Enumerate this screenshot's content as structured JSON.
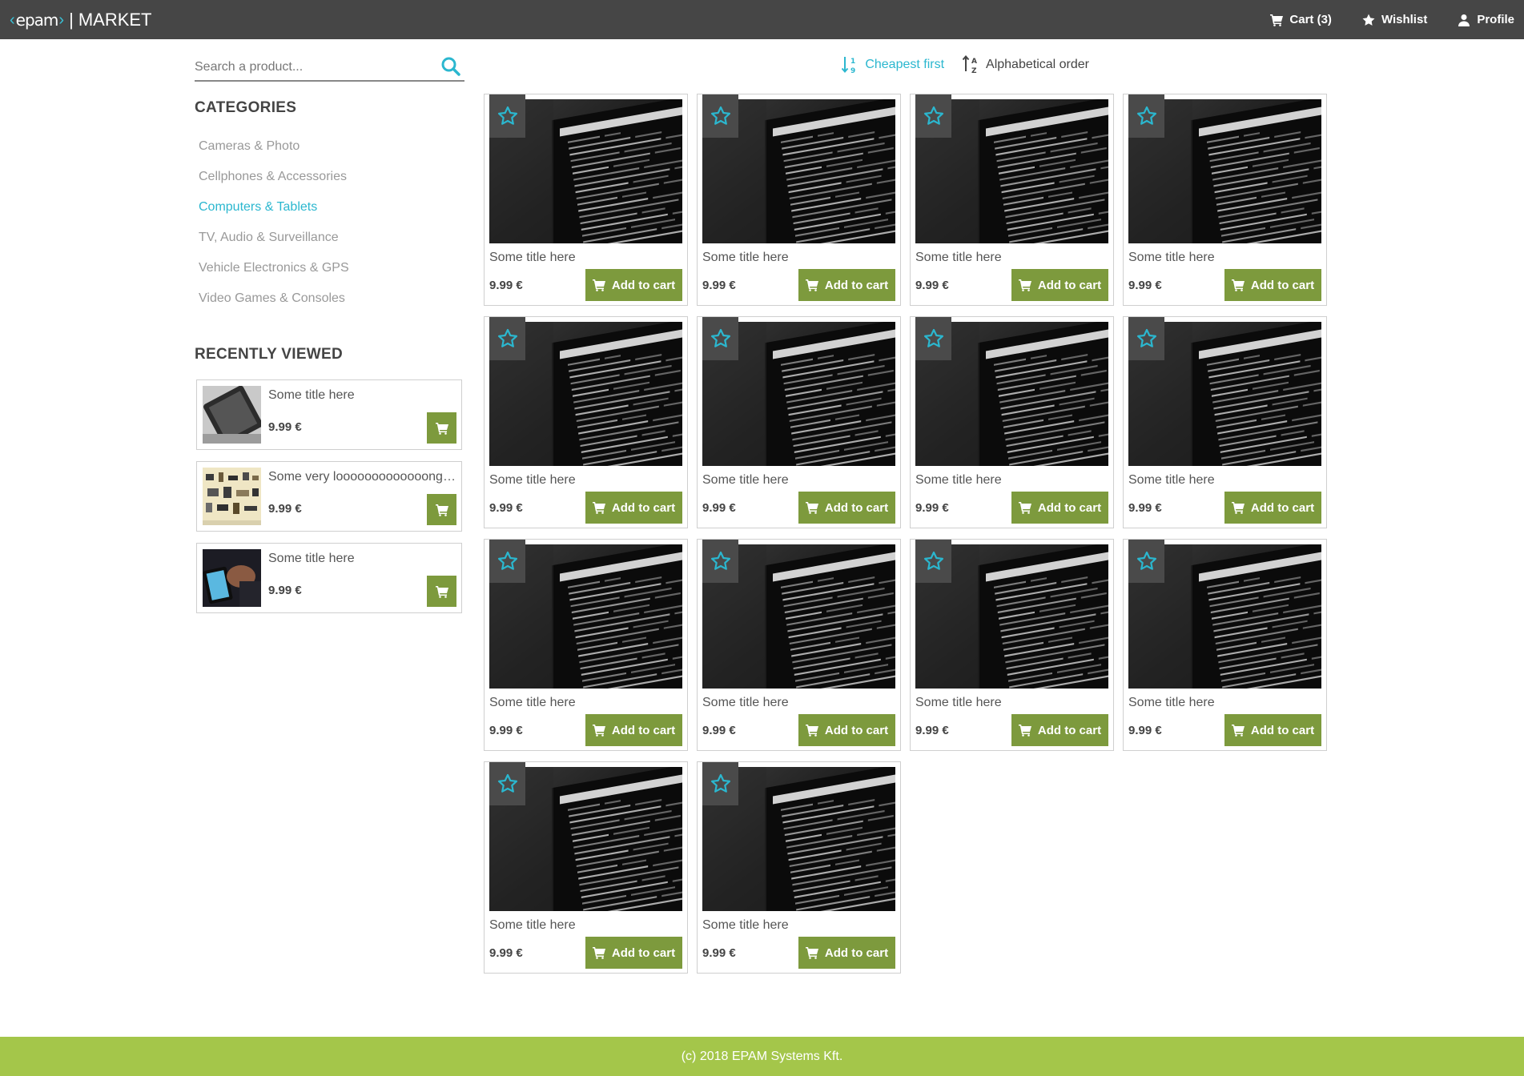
{
  "header": {
    "logo_text": "epam",
    "app_name": "MARKET",
    "separator": "|",
    "nav": [
      {
        "label": "Cart (3)",
        "icon": "cart-icon"
      },
      {
        "label": "Wishlist",
        "icon": "star-icon"
      },
      {
        "label": "Profile",
        "icon": "user-icon"
      }
    ]
  },
  "search": {
    "placeholder": "Search a product...",
    "value": ""
  },
  "sidebar": {
    "categories_heading": "CATEGORIES",
    "categories": [
      {
        "label": "Cameras & Photo",
        "active": false
      },
      {
        "label": "Cellphones & Accessories",
        "active": false
      },
      {
        "label": "Computers & Tablets",
        "active": true
      },
      {
        "label": "TV, Audio & Surveillance",
        "active": false
      },
      {
        "label": "Vehicle Electronics & GPS",
        "active": false
      },
      {
        "label": "Video Games & Consoles",
        "active": false
      }
    ],
    "recent_heading": "RECENTLY VIEWED",
    "recent": [
      {
        "title": "Some title here",
        "price": "9.99 €",
        "thumb": "tablet-gray"
      },
      {
        "title": "Some very looooooooooooong title",
        "price": "9.99 €",
        "thumb": "components"
      },
      {
        "title": "Some title here",
        "price": "9.99 €",
        "thumb": "hand-tablet"
      }
    ]
  },
  "sort": {
    "cheapest": "Cheapest first",
    "alphabetical": "Alphabetical order"
  },
  "products": [
    {
      "title": "Some title here",
      "price": "9.99 €",
      "button": "Add to cart"
    },
    {
      "title": "Some title here",
      "price": "9.99 €",
      "button": "Add to cart"
    },
    {
      "title": "Some title here",
      "price": "9.99 €",
      "button": "Add to cart"
    },
    {
      "title": "Some title here",
      "price": "9.99 €",
      "button": "Add to cart"
    },
    {
      "title": "Some title here",
      "price": "9.99 €",
      "button": "Add to cart"
    },
    {
      "title": "Some title here",
      "price": "9.99 €",
      "button": "Add to cart"
    },
    {
      "title": "Some title here",
      "price": "9.99 €",
      "button": "Add to cart"
    },
    {
      "title": "Some title here",
      "price": "9.99 €",
      "button": "Add to cart"
    },
    {
      "title": "Some title here",
      "price": "9.99 €",
      "button": "Add to cart"
    },
    {
      "title": "Some title here",
      "price": "9.99 €",
      "button": "Add to cart"
    },
    {
      "title": "Some title here",
      "price": "9.99 €",
      "button": "Add to cart"
    },
    {
      "title": "Some title here",
      "price": "9.99 €",
      "button": "Add to cart"
    },
    {
      "title": "Some title here",
      "price": "9.99 €",
      "button": "Add to cart"
    },
    {
      "title": "Some title here",
      "price": "9.99 €",
      "button": "Add to cart"
    }
  ],
  "footer": {
    "copyright": "(c) 2018 EPAM Systems Kft."
  },
  "colors": {
    "header_bg": "#464646",
    "accent": "#2bb7cf",
    "button": "#7d9a3d",
    "footer_bg": "#a4c64a"
  }
}
